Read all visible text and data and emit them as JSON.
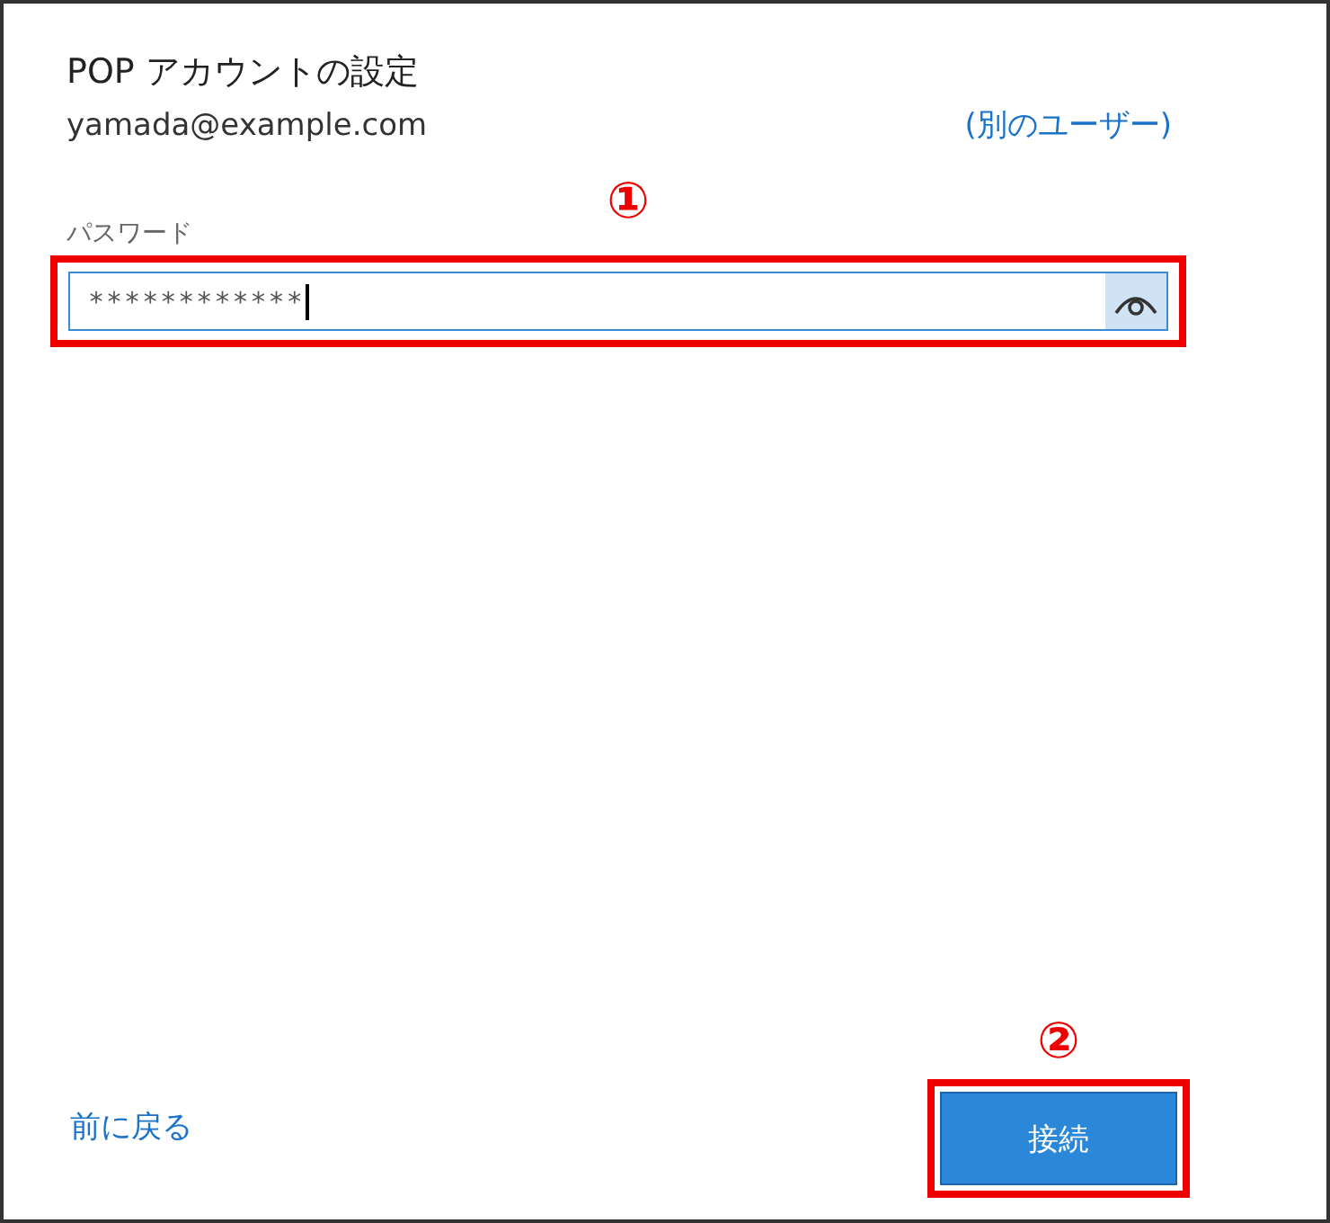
{
  "title": "POP アカウントの設定",
  "account": {
    "email": "yamada@example.com",
    "switch_link": "(別のユーザー)"
  },
  "password": {
    "label": "パスワード",
    "value": "************",
    "focused": true,
    "annotation": "①"
  },
  "back_link": "前に戻る",
  "connect_button": {
    "label": "接続",
    "annotation": "②"
  }
}
